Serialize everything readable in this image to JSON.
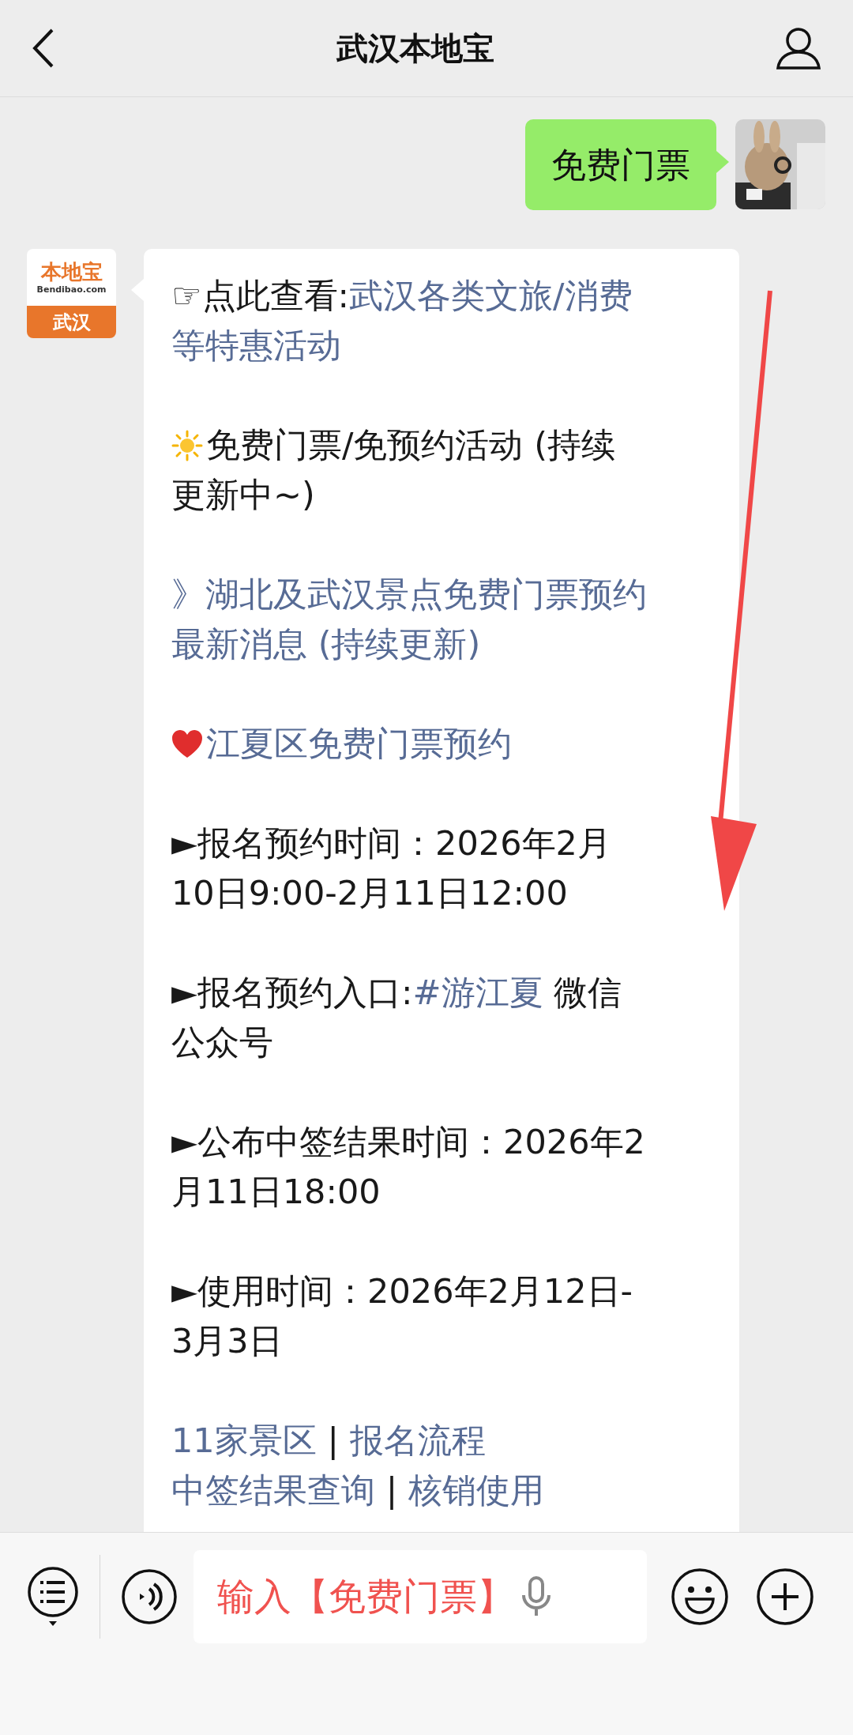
{
  "header": {
    "title": "武汉本地宝"
  },
  "sent_message": {
    "text": "免费门票"
  },
  "account_logo": {
    "brand": "本地宝",
    "domain": "Bendibao.com",
    "city": "武汉"
  },
  "article_message": {
    "paragraphs": [
      {
        "lines": [
          [
            {
              "kind": "text",
              "text": "☞点此查看:"
            },
            {
              "kind": "link",
              "text": "武汉各类文旅/消费"
            }
          ],
          [
            {
              "kind": "link",
              "text": "等特惠活动"
            }
          ]
        ]
      },
      {
        "lines": [
          [
            {
              "kind": "sun"
            },
            {
              "kind": "text",
              "text": "免费门票/免预约活动 (持续"
            }
          ],
          [
            {
              "kind": "text",
              "text": "更新中~)"
            }
          ]
        ]
      },
      {
        "lines": [
          [
            {
              "kind": "link",
              "text": "》湖北及武汉景点免费门票预约"
            }
          ],
          [
            {
              "kind": "link",
              "text": "最新消息 (持续更新)"
            }
          ]
        ]
      },
      {
        "lines": [
          [
            {
              "kind": "heart"
            },
            {
              "kind": "link",
              "text": "江夏区免费门票预约"
            }
          ]
        ]
      },
      {
        "lines": [
          [
            {
              "kind": "text",
              "text": "►报名预约时间：2026年2月"
            }
          ],
          [
            {
              "kind": "text",
              "text": "10日9:00-2月11日12:00"
            }
          ]
        ]
      },
      {
        "lines": [
          [
            {
              "kind": "text",
              "text": "►报名预约入口:"
            },
            {
              "kind": "link",
              "text": "#游江夏"
            },
            {
              "kind": "text",
              "text": " 微信"
            }
          ],
          [
            {
              "kind": "text",
              "text": "公众号"
            }
          ]
        ]
      },
      {
        "lines": [
          [
            {
              "kind": "text",
              "text": "►公布中签结果时间：2026年2"
            }
          ],
          [
            {
              "kind": "text",
              "text": "月11日18:00"
            }
          ]
        ]
      },
      {
        "lines": [
          [
            {
              "kind": "text",
              "text": "►使用时间：2026年2月12日-"
            }
          ],
          [
            {
              "kind": "text",
              "text": "3月3日"
            }
          ]
        ]
      },
      {
        "lines": [
          [
            {
              "kind": "link",
              "text": "11家景区"
            },
            {
              "kind": "text",
              "text": " | "
            },
            {
              "kind": "link",
              "text": "报名流程"
            }
          ],
          [
            {
              "kind": "link",
              "text": "中签结果查询"
            },
            {
              "kind": "text",
              "text": " | "
            },
            {
              "kind": "link",
              "text": "核销使用"
            }
          ]
        ]
      }
    ]
  },
  "input_bar": {
    "value": "输入【免费门票】"
  }
}
